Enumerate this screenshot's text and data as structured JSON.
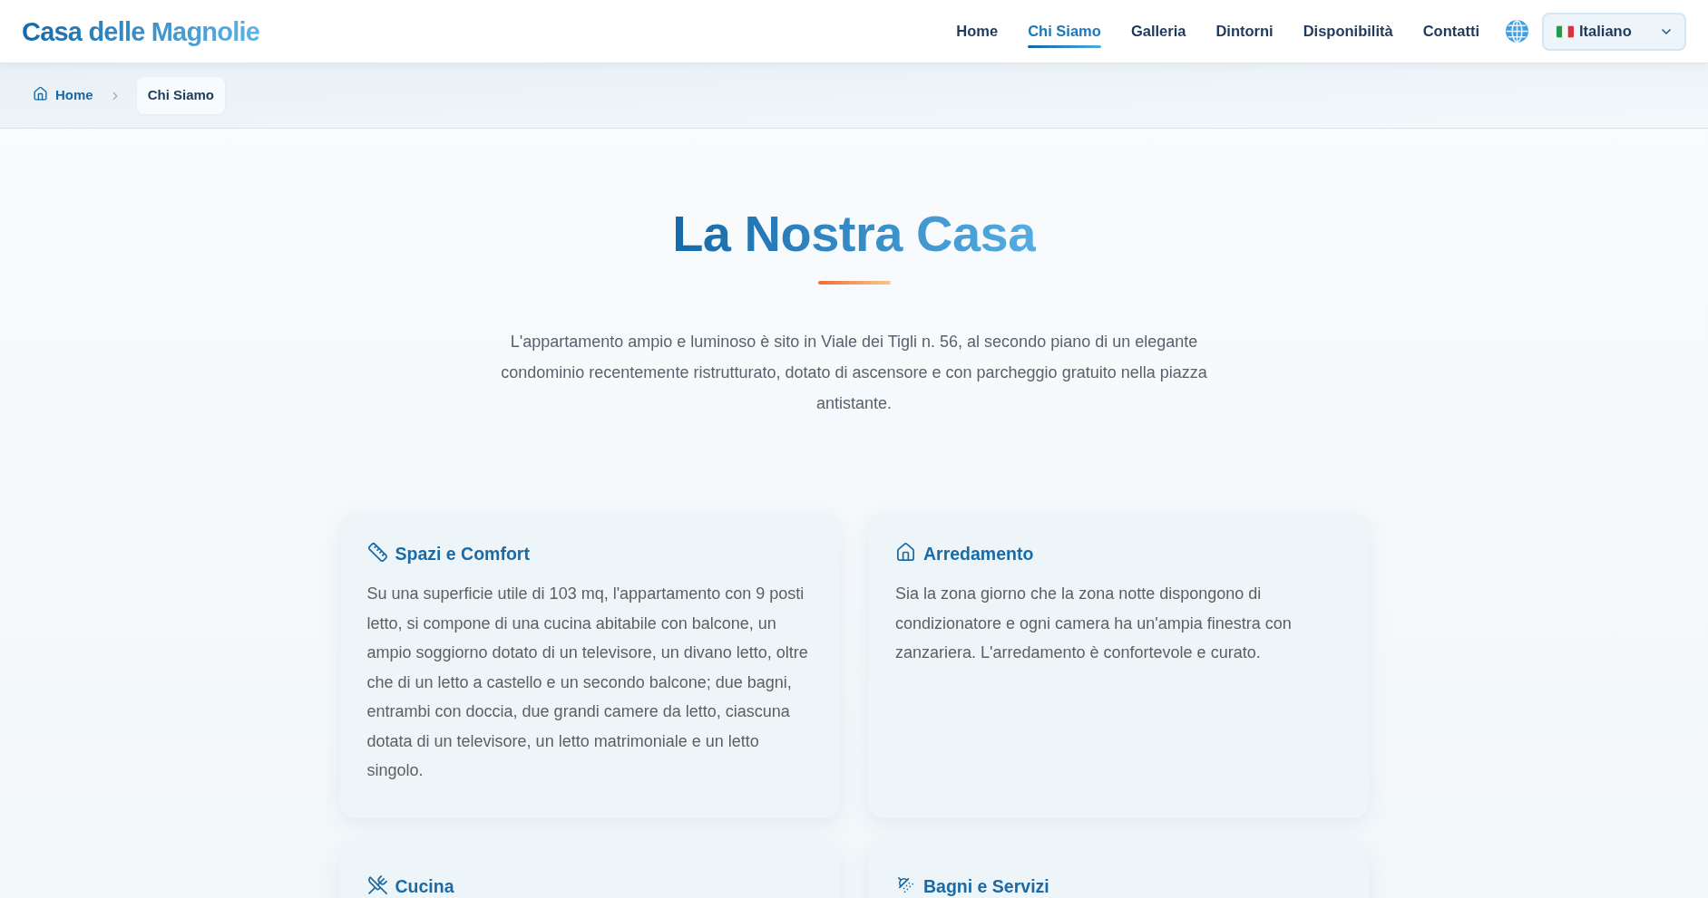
{
  "header": {
    "logo": "Casa delle Magnolie",
    "nav": [
      {
        "label": "Home",
        "selected": false
      },
      {
        "label": "Chi Siamo",
        "selected": true
      },
      {
        "label": "Galleria",
        "selected": false
      },
      {
        "label": "Dintorni",
        "selected": false
      },
      {
        "label": "Disponibilità",
        "selected": false
      },
      {
        "label": "Contatti",
        "selected": false
      }
    ],
    "language": {
      "value": "Italiano"
    }
  },
  "breadcrumb": [
    {
      "label": "Home",
      "current": false
    },
    {
      "label": "Chi Siamo",
      "current": true
    }
  ],
  "hero": {
    "title": "La Nostra Casa",
    "text": "L'appartamento ampio e luminoso è sito in Viale dei Tigli n. 56, al secondo piano di un elegante condominio recentemente ristrutturato, dotato di ascensore e con parcheggio gratuito nella piazza antistante."
  },
  "cards": [
    {
      "title": "Spazi e Comfort",
      "text": "Su una superficie utile di 103 mq, l'appartamento con 9 posti letto, si compone di una cucina abitabile con balcone, un ampio soggiorno dotato di un televisore, un divano letto, oltre che di un letto a castello e un secondo balcone; due bagni, entrambi con doccia, due grandi camere da letto, ciascuna dotata di un televisore, un letto matrimoniale e un letto singolo."
    },
    {
      "title": "Arredamento",
      "text": "Sia la zona giorno che la zona notte dispongono di condizionatore e ogni camera ha un'ampia finestra con zanzariera. L'arredamento è confortevole e curato."
    },
    {
      "title": "Cucina"
    },
    {
      "title": "Bagni e Servizi"
    }
  ]
}
